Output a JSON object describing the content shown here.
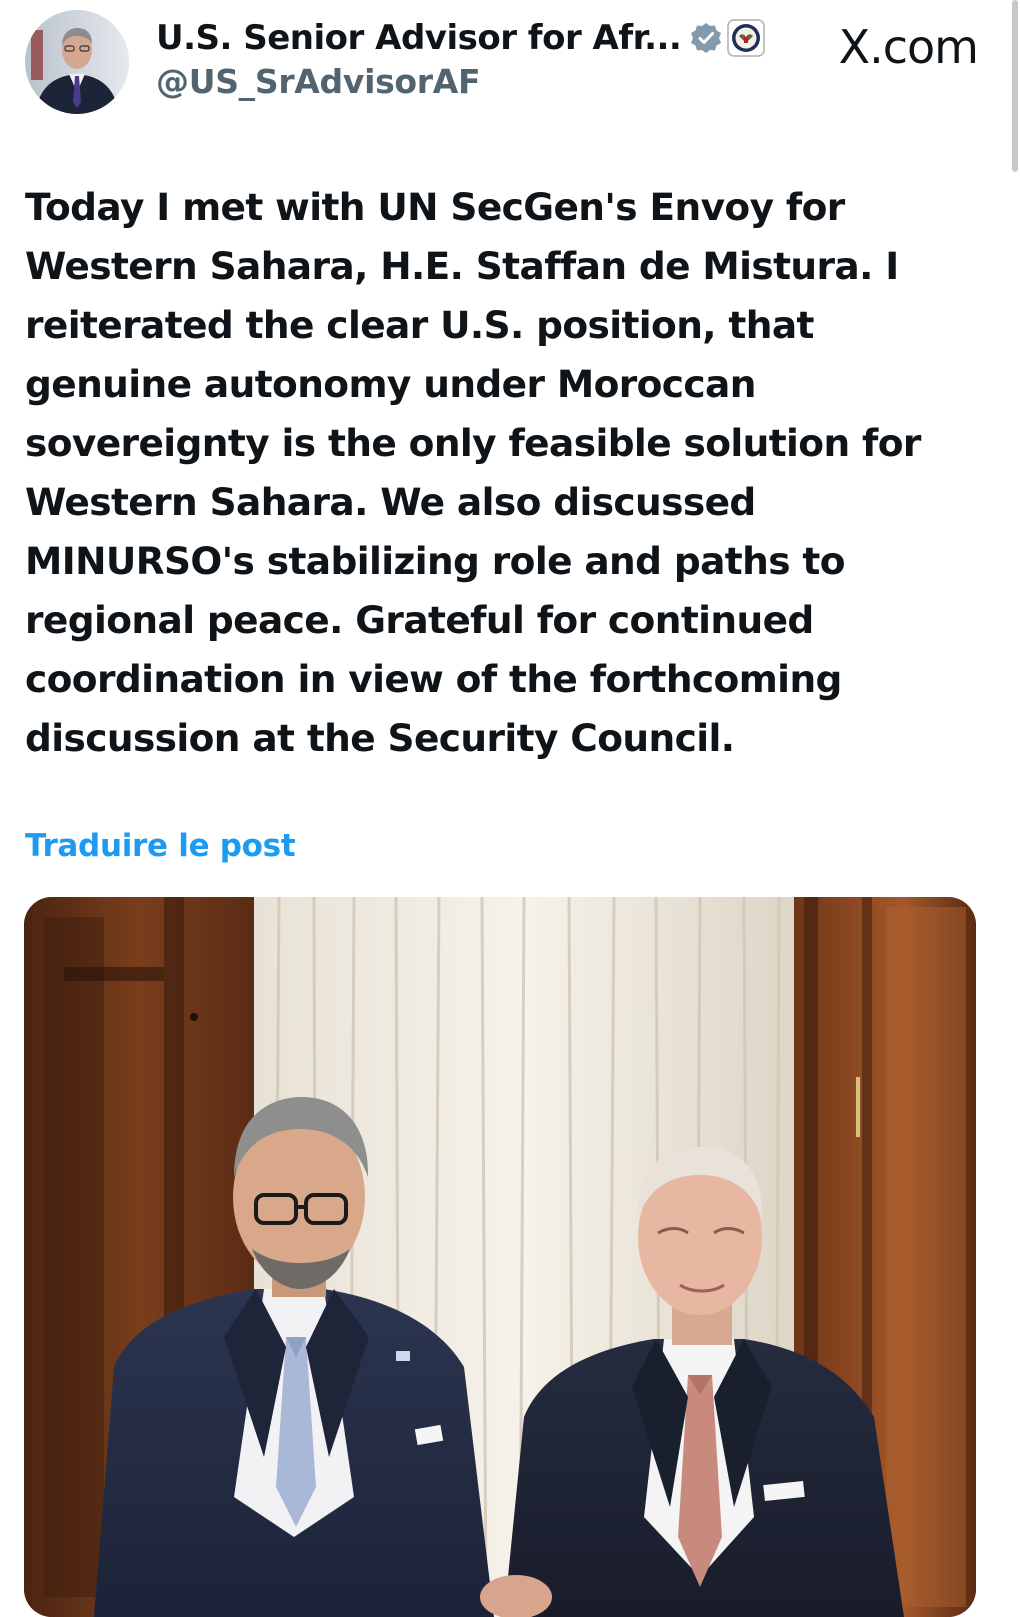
{
  "author": {
    "display_name": "U.S. Senior Advisor for Afr...",
    "handle": "@US_SrAdvisorAF",
    "verified_icon": "verified-badge-icon",
    "affiliation_icon": "state-department-seal-icon"
  },
  "site_label": "X.com",
  "post": {
    "text": "Today I met with UN SecGen's Envoy for Western Sahara, H.E. Staffan de Mistura. I reiterated the clear U.S. position, that genuine autonomy under Moroccan sovereignty is the only feasible solution for Western Sahara. We also discussed MINURSO's stabilizing role and paths to regional peace. Grateful for continued coordination in view of the forthcoming discussion at the Security Council.",
    "translate_label": "Traduire le post"
  },
  "colors": {
    "link": "#1d9bf0",
    "secondary_text": "#536471",
    "verified": "#829aab"
  }
}
